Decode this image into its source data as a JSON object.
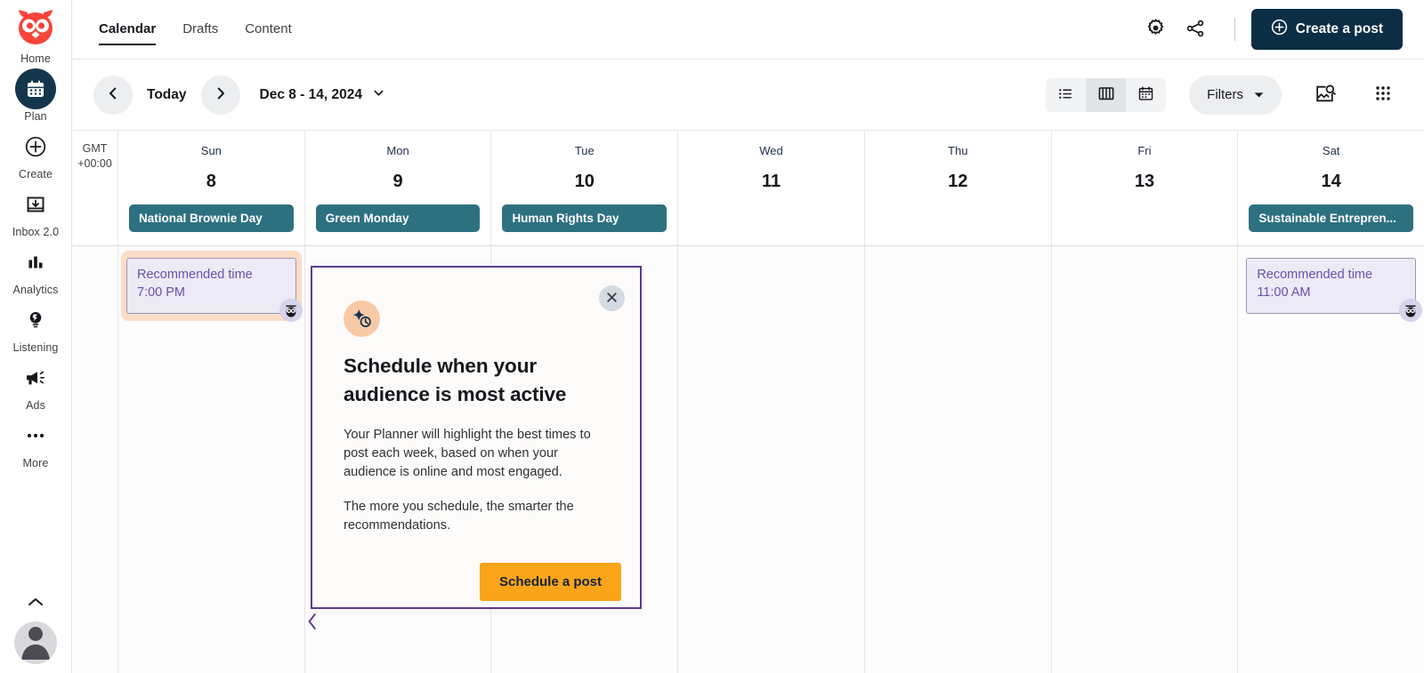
{
  "rail": {
    "logo_icon": "owl-logo",
    "items": [
      {
        "label": "Home",
        "icon": "owl-logo-icon",
        "active": false
      },
      {
        "label": "Plan",
        "icon": "calendar-icon",
        "active": true
      },
      {
        "label": "Create",
        "icon": "plus-circle-icon",
        "active": false
      },
      {
        "label": "Inbox 2.0",
        "icon": "inbox-icon",
        "active": false
      },
      {
        "label": "Analytics",
        "icon": "bar-chart-icon",
        "active": false
      },
      {
        "label": "Listening",
        "icon": "lightbulb-icon",
        "active": false
      },
      {
        "label": "Ads",
        "icon": "megaphone-icon",
        "active": false
      },
      {
        "label": "More",
        "icon": "ellipsis-icon",
        "active": false
      }
    ],
    "collapse_icon": "chevron-up-icon",
    "avatar_icon": "user-avatar-icon"
  },
  "topbar": {
    "tabs": [
      {
        "label": "Calendar",
        "active": true
      },
      {
        "label": "Drafts",
        "active": false
      },
      {
        "label": "Content",
        "active": false
      }
    ],
    "settings_icon": "gear-icon",
    "share_icon": "share-icon",
    "create_post_label": "Create a post",
    "create_post_icon": "plus-circle-icon"
  },
  "toolbar": {
    "prev_icon": "chevron-left-icon",
    "next_icon": "chevron-right-icon",
    "today_label": "Today",
    "date_range": "Dec 8 - 14, 2024",
    "date_caret_icon": "chevron-down-icon",
    "views": [
      {
        "name": "list-view",
        "icon": "list-icon",
        "active": false
      },
      {
        "name": "week-view",
        "icon": "columns-icon",
        "active": true
      },
      {
        "name": "month-view",
        "icon": "calendar-grid-icon",
        "active": false
      }
    ],
    "filters_label": "Filters",
    "filters_caret_icon": "caret-down-icon",
    "media_search_icon": "image-search-icon",
    "apps_icon": "grid-dots-icon"
  },
  "calendar": {
    "timezone": {
      "line1": "GMT",
      "line2": "+00:00"
    },
    "days": [
      {
        "dow": "Sun",
        "num": "8",
        "holiday": "National Brownie Day"
      },
      {
        "dow": "Mon",
        "num": "9",
        "holiday": "Green Monday"
      },
      {
        "dow": "Tue",
        "num": "10",
        "holiday": "Human Rights Day"
      },
      {
        "dow": "Wed",
        "num": "11",
        "holiday": ""
      },
      {
        "dow": "Thu",
        "num": "12",
        "holiday": ""
      },
      {
        "dow": "Fri",
        "num": "13",
        "holiday": ""
      },
      {
        "dow": "Sat",
        "num": "14",
        "holiday": "Sustainable Entrepren..."
      }
    ],
    "recommendations": [
      {
        "day_index": 0,
        "title": "Recommended time",
        "time": "7:00 PM",
        "highlighted": true,
        "badge_icon": "owl-icon"
      },
      {
        "day_index": 6,
        "title": "Recommended time",
        "time": "11:00 AM",
        "highlighted": false,
        "badge_icon": "owl-icon"
      }
    ]
  },
  "popover": {
    "icon": "sparkle-clock-icon",
    "close_icon": "close-icon",
    "title": "Schedule when your audience is most active",
    "paragraph1": "Your Planner will highlight the best times to post each week, based on when your audience is online and most engaged.",
    "paragraph2": "The more you schedule, the smarter the recommendations.",
    "cta_label": "Schedule a post",
    "pointer_icon": "chevron-left-icon"
  },
  "colors": {
    "brand_red": "#f8443b",
    "navy": "#0c2e44",
    "teal_holiday": "#2d7181",
    "purple_accent": "#6b4fb0",
    "popover_border": "#5b3b8c",
    "cta_orange": "#faa41a",
    "highlight_peach": "#fbddc6"
  }
}
